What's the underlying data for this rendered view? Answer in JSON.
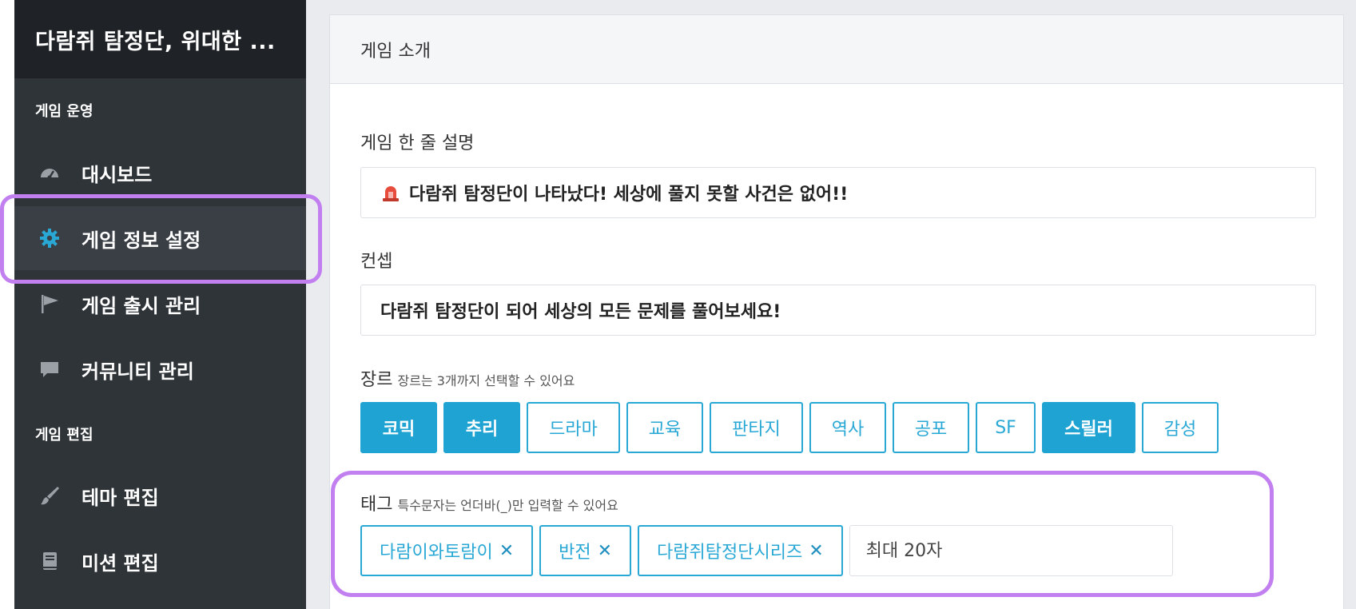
{
  "sidebar": {
    "title": "다람쥐 탐정단, 위대한 ...",
    "sections": {
      "operation": "게임 운영",
      "edit": "게임 편집"
    },
    "items": {
      "dashboard": "대시보드",
      "game_info": "게임 정보 설정",
      "release": "게임 출시 관리",
      "community": "커뮤니티 관리",
      "theme": "테마 편집",
      "mission": "미션 편집"
    },
    "active_item": "게임 정보 설정"
  },
  "card": {
    "title": "게임 소개",
    "one_line": {
      "label": "게임 한 줄 설명",
      "value": "다람쥐 탐정단이 나타났다! 세상에 풀지 못할 사건은 없어!!"
    },
    "concept": {
      "label": "컨셉",
      "value": "다람쥐 탐정단이 되어 세상의 모든 문제를 풀어보세요!"
    },
    "genre": {
      "label": "장르",
      "hint": "장르는 3개까지 선택할 수 있어요",
      "options": [
        "코믹",
        "추리",
        "드라마",
        "교육",
        "판타지",
        "역사",
        "공포",
        "SF",
        "스릴러",
        "감성"
      ],
      "selected": [
        "코믹",
        "추리",
        "스릴러"
      ]
    },
    "tags": {
      "label": "태그",
      "hint": "특수문자는 언더바(_)만 입력할 수 있어요",
      "items": [
        "다람이와토람이",
        "반전",
        "다람쥐탐정단시리즈"
      ],
      "remove_glyph": "✕",
      "placeholder": "최대 20자"
    }
  },
  "colors": {
    "accent": "#1fa3d3",
    "sidebar_bg": "#2f3439",
    "highlight": "#c27ff0"
  }
}
